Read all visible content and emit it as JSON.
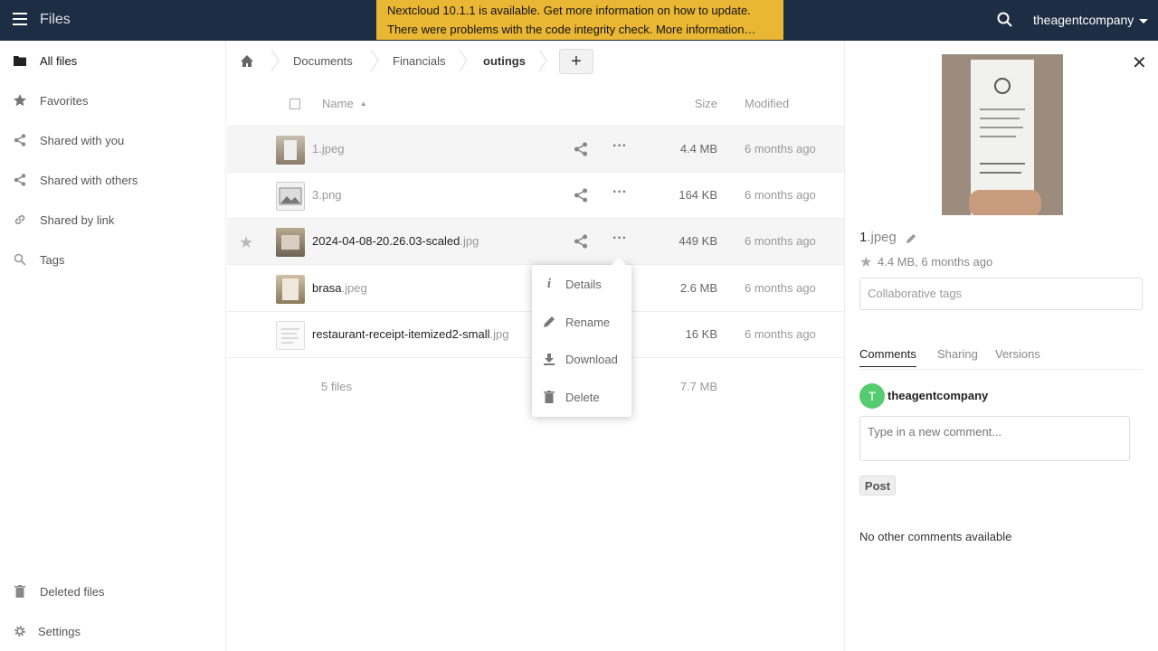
{
  "header": {
    "app_title": "Files",
    "banner_line1": "Nextcloud 10.1.1 is available. Get more information on how to update.",
    "banner_line2": "There were problems with the code integrity check. More information…",
    "user_name": "theagentcompany"
  },
  "sidebar": {
    "items": [
      {
        "label": "All files",
        "icon": "folder-icon"
      },
      {
        "label": "Favorites",
        "icon": "star-icon"
      },
      {
        "label": "Shared with you",
        "icon": "share-icon"
      },
      {
        "label": "Shared with others",
        "icon": "share-icon"
      },
      {
        "label": "Shared by link",
        "icon": "link-icon"
      },
      {
        "label": "Tags",
        "icon": "tag-search-icon"
      }
    ],
    "deleted_label": "Deleted files",
    "settings_label": "Settings"
  },
  "breadcrumb": {
    "items": [
      "Documents",
      "Financials",
      "outings"
    ],
    "add_label": "+"
  },
  "list": {
    "col_name": "Name",
    "col_size": "Size",
    "col_modified": "Modified",
    "files": [
      {
        "base": "1",
        "ext": ".jpeg",
        "size": "4.4 MB",
        "modified": "6 months ago"
      },
      {
        "base": "3",
        "ext": ".png",
        "size": "164 KB",
        "modified": "6 months ago"
      },
      {
        "base": "2024-04-08-20.26.03-scaled",
        "ext": ".jpg",
        "size": "449 KB",
        "modified": "6 months ago"
      },
      {
        "base": "brasa",
        "ext": ".jpeg",
        "size": "2.6 MB",
        "modified": "6 months ago"
      },
      {
        "base": "restaurant-receipt-itemized2-small",
        "ext": ".jpg",
        "size": "16 KB",
        "modified": "6 months ago"
      }
    ],
    "summary_count": "5 files",
    "summary_size": "7.7 MB"
  },
  "popover": {
    "details": "Details",
    "rename": "Rename",
    "download": "Download",
    "delete": "Delete"
  },
  "details": {
    "title_base": "1",
    "title_ext": ".jpeg",
    "meta": "4.4 MB, 6 months ago",
    "tags_placeholder": "Collaborative tags",
    "tabs": [
      "Comments",
      "Sharing",
      "Versions"
    ],
    "avatar_letter": "T",
    "author": "theagentcompany",
    "comment_placeholder": "Type in a new comment...",
    "post_label": "Post",
    "no_comments": "No other comments available"
  },
  "colors": {
    "header_bg": "#1d2d44",
    "banner_bg": "#e9b734",
    "avatar_bg": "#55cc6f"
  }
}
